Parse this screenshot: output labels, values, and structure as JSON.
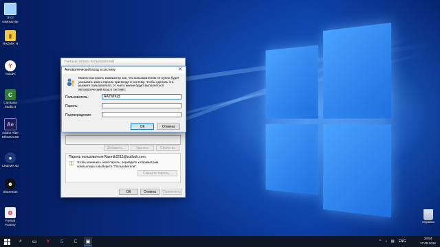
{
  "desktop": {
    "icons": [
      {
        "label": "Этот компьютер"
      },
      {
        "label": "RAZMIK H"
      },
      {
        "label": "Yandex"
      },
      {
        "label": "Camtasia Studio 8"
      },
      {
        "label": "Adobe After Effects CS6"
      },
      {
        "label": "CINEMA 4D"
      },
      {
        "label": "Shareman"
      },
      {
        "label": "Format Factory"
      }
    ],
    "recycle_bin": "Корзина"
  },
  "settings_window": {
    "title": "Учетные записи пользователей",
    "add_button": "Добавить...",
    "remove_button": "Удалить",
    "properties_button": "Свойства",
    "password_group_title": "Пароль пользователя Razmik2215@outlook.com",
    "password_group_text": "Чтобы изменить свой пароль, перейдите к параметрам компьютера и выберите \"Пользователи\".",
    "reset_password_button": "Сменить пароль...",
    "ok_button": "ОК",
    "cancel_button": "Отмена",
    "apply_button": "Применить"
  },
  "auto_login_dialog": {
    "title": "Автоматический вход в систему",
    "description": "Можно настроить компьютер так, что пользователям не нужно будет указывать имя и пароль при входе в систему. Чтобы сделать это, укажите пользователя, от чьего имени будет выполняться автоматический вход в систему:",
    "username_label": "Пользователь:",
    "username_value": "RAZMIK@",
    "password_label": "Пароль:",
    "password_value": "",
    "confirm_label": "Подтверждение:",
    "confirm_value": "",
    "ok_button": "ОК",
    "cancel_button": "Отмена"
  },
  "taskbar": {
    "language": "ENG",
    "time": "23:54",
    "date": "17.08.2015"
  }
}
